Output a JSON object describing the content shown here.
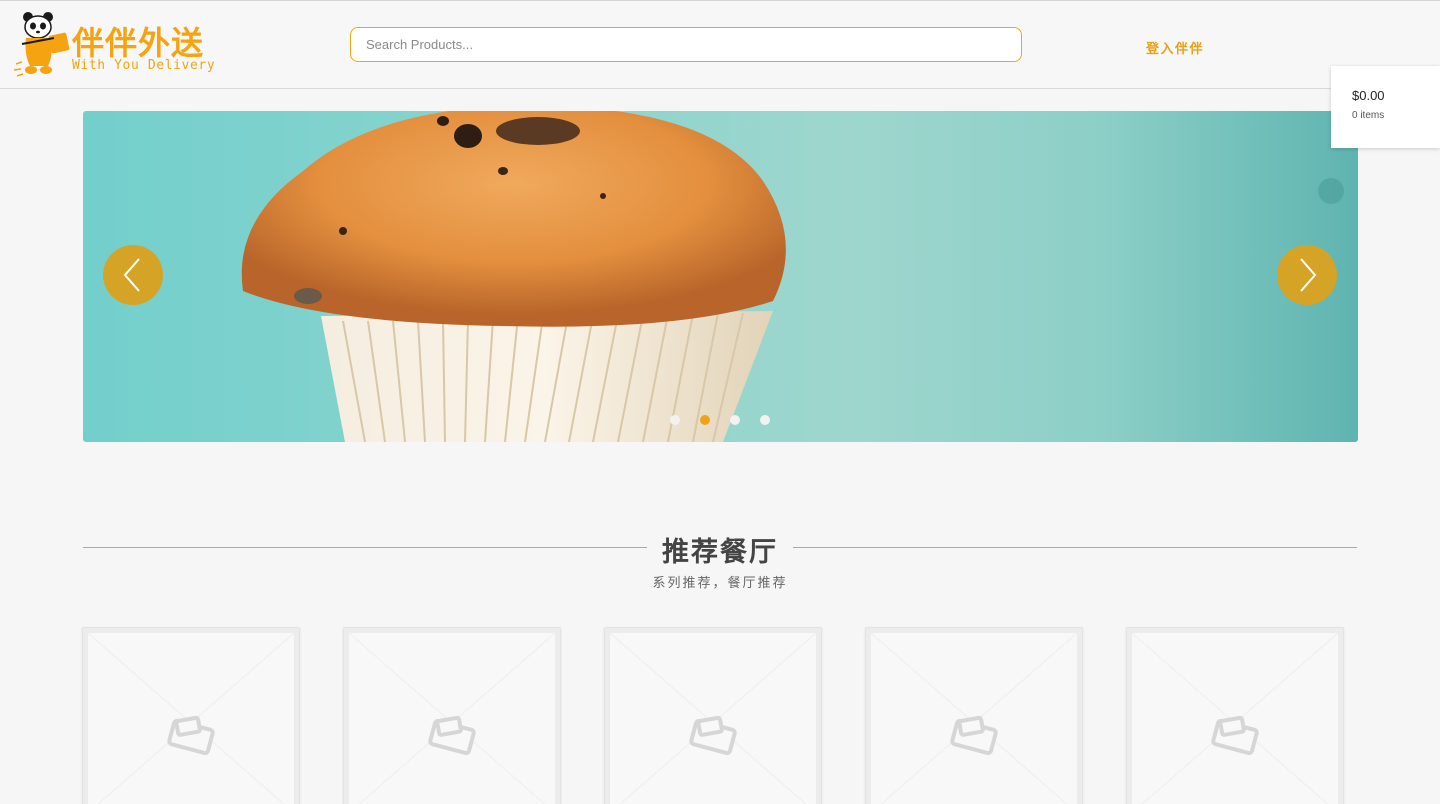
{
  "header": {
    "logo": {
      "cn": "伴伴外送",
      "en": "With You Delivery"
    },
    "search": {
      "placeholder": "Search Products..."
    },
    "login_label": "登入伴伴",
    "cart": {
      "total": "$0.00",
      "items": "0 items"
    }
  },
  "carousel": {
    "slide_count": 4,
    "active_index": 1,
    "prev_icon": "chevron-left-icon",
    "next_icon": "chevron-right-icon"
  },
  "section": {
    "title": "推荐餐厅",
    "subtitle": "系列推荐，餐厅推荐"
  },
  "cards": [
    {
      "icon": "image-placeholder-icon"
    },
    {
      "icon": "image-placeholder-icon"
    },
    {
      "icon": "image-placeholder-icon"
    },
    {
      "icon": "image-placeholder-icon"
    },
    {
      "icon": "image-placeholder-icon"
    }
  ],
  "colors": {
    "accent": "#f5a310",
    "arrow_bg": "#d5a326",
    "background": "#f6f6f6"
  }
}
